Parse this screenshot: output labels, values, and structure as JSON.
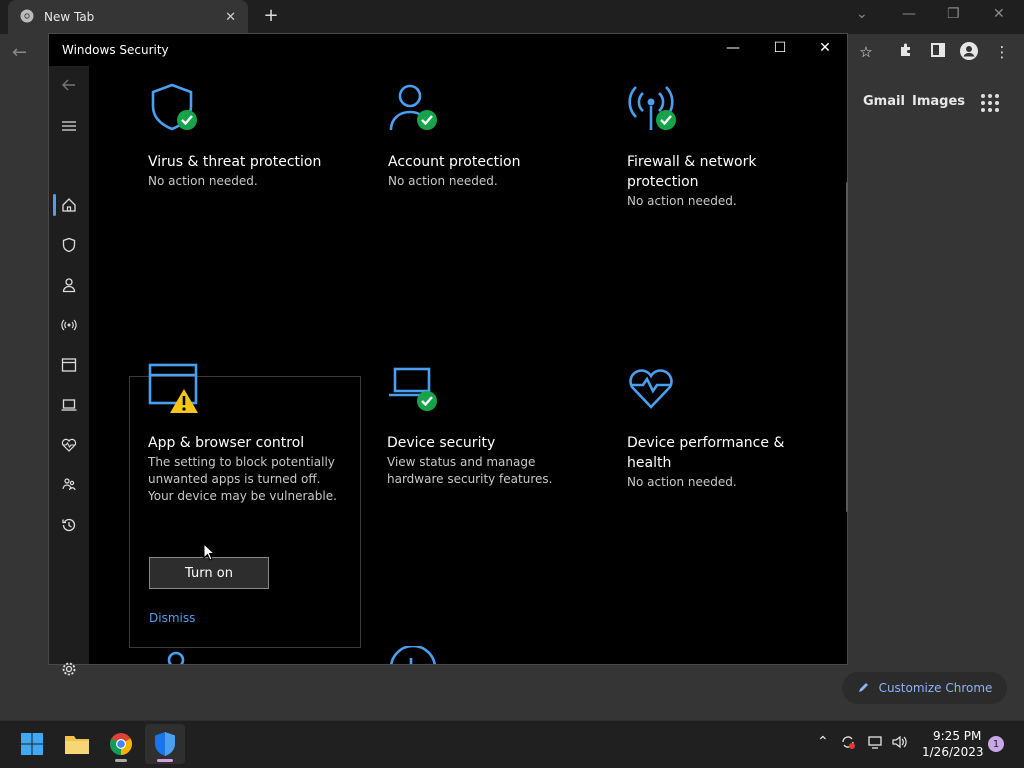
{
  "chrome": {
    "tab_title": "New Tab",
    "gmail": "Gmail",
    "images": "Images",
    "customize": "Customize Chrome"
  },
  "window": {
    "title": "Windows Security"
  },
  "tiles": {
    "virus": {
      "heading": "Virus & threat protection",
      "status": "No action needed."
    },
    "account": {
      "heading": "Account protection",
      "status": "No action needed."
    },
    "firewall": {
      "heading_line1": "Firewall & network",
      "heading_line2": "protection",
      "status": "No action needed."
    },
    "app_browser": {
      "heading": "App & browser control",
      "status_line1": "The setting to block potentially",
      "status_line2": "unwanted apps is turned off.",
      "status_line3": "Your device may be vulnerable.",
      "button": "Turn on",
      "dismiss": "Dismiss"
    },
    "device_security": {
      "heading": "Device security",
      "status_line1": "View status and manage",
      "status_line2": "hardware security features."
    },
    "device_perf": {
      "heading_line1": "Device performance &",
      "heading_line2": "health",
      "status": "No action needed."
    }
  },
  "taskbar": {
    "time": "9:25 PM",
    "date": "1/26/2023",
    "badge": "1"
  },
  "colors": {
    "accent_blue": "#4aa0f0",
    "ok_green": "#16a34a",
    "warn_yellow": "#f5c518"
  }
}
